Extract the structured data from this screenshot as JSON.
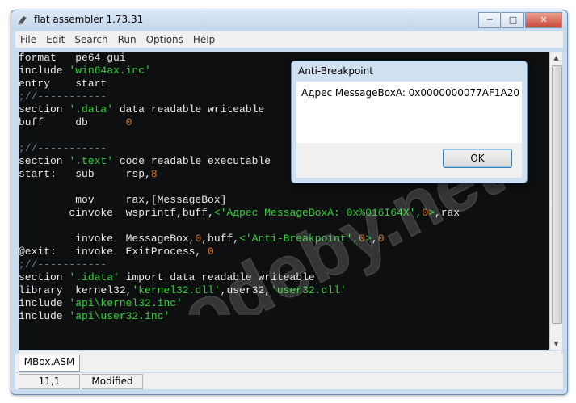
{
  "window": {
    "title": "flat assembler 1.73.31",
    "min_glyph": "─",
    "max_glyph": "□",
    "close_glyph": "✕"
  },
  "menu": [
    "File",
    "Edit",
    "Search",
    "Run",
    "Options",
    "Help"
  ],
  "editor": {
    "lines": [
      [
        [
          "t",
          "format   pe64 gui"
        ]
      ],
      [
        [
          "t",
          "include "
        ],
        [
          "s",
          "'win64ax.inc'"
        ]
      ],
      [
        [
          "t",
          "entry    start"
        ]
      ],
      [
        [
          "c",
          ";//-----------"
        ]
      ],
      [
        [
          "t",
          "section "
        ],
        [
          "s",
          "'.data'"
        ],
        [
          "t",
          " data readable writeable"
        ]
      ],
      [
        [
          "t",
          "buff     db      "
        ],
        [
          "n",
          "0"
        ]
      ],
      [
        [
          "t",
          ""
        ]
      ],
      [
        [
          "c",
          ";//-----------"
        ]
      ],
      [
        [
          "t",
          "section "
        ],
        [
          "s",
          "'.text'"
        ],
        [
          "t",
          " code readable executable"
        ]
      ],
      [
        [
          "t",
          "start:   sub     rsp,"
        ],
        [
          "n",
          "8"
        ]
      ],
      [
        [
          "t",
          ""
        ]
      ],
      [
        [
          "t",
          "         mov     rax,[MessageBox]"
        ]
      ],
      [
        [
          "t",
          "        cinvoke  wsprintf,buff,"
        ],
        [
          "s",
          "<'Адрес MessageBoxA: 0x%016I64X',"
        ],
        [
          "n",
          "0"
        ],
        [
          "s",
          ">"
        ],
        [
          "t",
          ",rax"
        ]
      ],
      [
        [
          "t",
          ""
        ]
      ],
      [
        [
          "t",
          "         invoke  MessageBox,"
        ],
        [
          "n",
          "0"
        ],
        [
          "t",
          ",buff,"
        ],
        [
          "s",
          "<'Anti-Breakpoint',"
        ],
        [
          "n",
          "0"
        ],
        [
          "s",
          ">"
        ],
        [
          "t",
          ","
        ],
        [
          "n",
          "0"
        ]
      ],
      [
        [
          "t",
          "@exit:   invoke  ExitProcess, "
        ],
        [
          "n",
          "0"
        ]
      ],
      [
        [
          "c",
          ";//-----------"
        ]
      ],
      [
        [
          "t",
          "section "
        ],
        [
          "s",
          "'.idata'"
        ],
        [
          "t",
          " import data readable writeable"
        ]
      ],
      [
        [
          "t",
          "library  kernel32,"
        ],
        [
          "s",
          "'kernel32.dll'"
        ],
        [
          "t",
          ",user32,"
        ],
        [
          "s",
          "'user32.dll'"
        ]
      ],
      [
        [
          "t",
          "include "
        ],
        [
          "s",
          "'api\\kernel32.inc'"
        ]
      ],
      [
        [
          "t",
          "include "
        ],
        [
          "s",
          "'api\\user32.inc'"
        ]
      ]
    ],
    "colors": {
      "text": "#e8e8e8",
      "string": "#36d036",
      "number": "#e07420",
      "comment": "#6e7a8a",
      "background": "#0d0f11"
    }
  },
  "tabs": [
    {
      "label": "MBox.ASM"
    }
  ],
  "status": {
    "position": "11,1",
    "state": "Modified"
  },
  "dialog": {
    "title": "Anti-Breakpoint",
    "message": "Адрес MessageBoxA: 0x0000000077AF1A20",
    "ok_label": "OK"
  },
  "watermark": {
    "text": "codeby.net"
  },
  "icons": {
    "app": "fasm-icon",
    "scroll_up": "▲",
    "scroll_down": "▼"
  }
}
